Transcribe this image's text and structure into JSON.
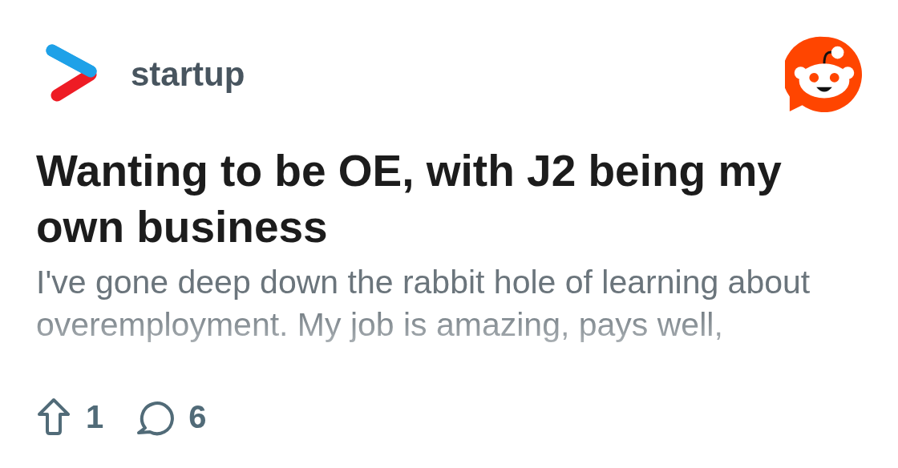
{
  "community": {
    "name": "startup"
  },
  "post": {
    "title": "Wanting to be OE, with J2 being my own business",
    "excerpt": "I've gone deep down the rabbit hole of learning about overemployment. My job is amazing, pays well,"
  },
  "stats": {
    "upvotes": "1",
    "comments": "6"
  }
}
